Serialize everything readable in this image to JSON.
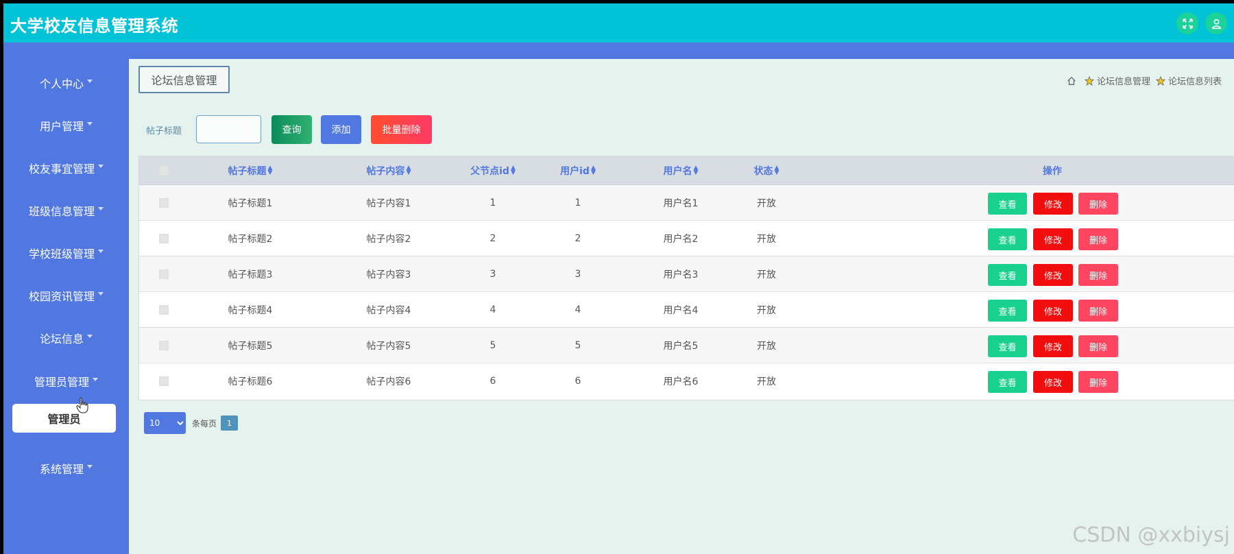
{
  "header": {
    "title": "大学校友信息管理系统"
  },
  "sidebar": {
    "items": [
      {
        "label": "个人中心"
      },
      {
        "label": "用户管理"
      },
      {
        "label": "校友事宜管理"
      },
      {
        "label": "班级信息管理"
      },
      {
        "label": "学校班级管理"
      },
      {
        "label": "校园资讯管理"
      },
      {
        "label": "论坛信息"
      },
      {
        "label": "管理员管理"
      },
      {
        "label": "系统管理"
      }
    ],
    "active_sub": "管理员"
  },
  "page": {
    "tab_label": "论坛信息管理",
    "breadcrumb": [
      "论坛信息管理",
      "论坛信息列表"
    ]
  },
  "search": {
    "label": "帖子标题",
    "value": "",
    "query_label": "查询",
    "add_label": "添加",
    "bulk_delete_label": "批量删除"
  },
  "table": {
    "headers": [
      "帖子标题",
      "帖子内容",
      "父节点id",
      "用户id",
      "用户名",
      "状态",
      "操作"
    ],
    "rows": [
      {
        "title": "帖子标题1",
        "content": "帖子内容1",
        "parent_id": "1",
        "user_id": "1",
        "username": "用户名1",
        "status": "开放"
      },
      {
        "title": "帖子标题2",
        "content": "帖子内容2",
        "parent_id": "2",
        "user_id": "2",
        "username": "用户名2",
        "status": "开放"
      },
      {
        "title": "帖子标题3",
        "content": "帖子内容3",
        "parent_id": "3",
        "user_id": "3",
        "username": "用户名3",
        "status": "开放"
      },
      {
        "title": "帖子标题4",
        "content": "帖子内容4",
        "parent_id": "4",
        "user_id": "4",
        "username": "用户名4",
        "status": "开放"
      },
      {
        "title": "帖子标题5",
        "content": "帖子内容5",
        "parent_id": "5",
        "user_id": "5",
        "username": "用户名5",
        "status": "开放"
      },
      {
        "title": "帖子标题6",
        "content": "帖子内容6",
        "parent_id": "6",
        "user_id": "6",
        "username": "用户名6",
        "status": "开放"
      }
    ],
    "actions": {
      "view": "查看",
      "edit": "修改",
      "delete": "删除"
    }
  },
  "pagination": {
    "page_size": "10",
    "per_page_label": "条每页",
    "current_page": "1"
  },
  "watermark": "CSDN @xxbiysj",
  "colors": {
    "topbar": "#00c3d8",
    "sidebar": "#5178e0",
    "content_bg": "#e6f2ee"
  }
}
